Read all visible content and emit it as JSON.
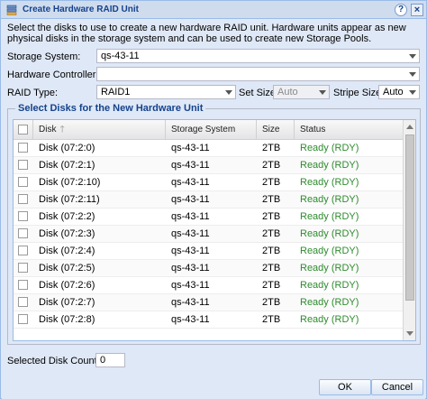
{
  "dialog": {
    "title": "Create Hardware RAID Unit",
    "title_icon": "raid-unit-icon",
    "help_label": "?",
    "close_label": "×"
  },
  "description": "Select the disks to use to create a new hardware RAID unit. Hardware units appear as new physical disks in the storage system and can be used to create new Storage Pools.",
  "form": {
    "storage_system_label": "Storage System:",
    "storage_system_value": "qs-43-11",
    "hardware_controller_label": "Hardware Controller:",
    "hardware_controller_value": "",
    "raid_type_label": "RAID Type:",
    "raid_type_value": "RAID1",
    "set_size_label": "Set Size:",
    "set_size_value": "Auto",
    "stripe_size_label": "Stripe Size:",
    "stripe_size_value": "Auto"
  },
  "disk_section": {
    "legend": "Select Disks for the New Hardware Unit",
    "columns": [
      "Disk",
      "Storage System",
      "Size",
      "Status"
    ],
    "rows": [
      {
        "disk": "Disk (07:2:0)",
        "system": "qs-43-11",
        "size": "2TB",
        "status": "Ready (RDY)"
      },
      {
        "disk": "Disk (07:2:1)",
        "system": "qs-43-11",
        "size": "2TB",
        "status": "Ready (RDY)"
      },
      {
        "disk": "Disk (07:2:10)",
        "system": "qs-43-11",
        "size": "2TB",
        "status": "Ready (RDY)"
      },
      {
        "disk": "Disk (07:2:11)",
        "system": "qs-43-11",
        "size": "2TB",
        "status": "Ready (RDY)"
      },
      {
        "disk": "Disk (07:2:2)",
        "system": "qs-43-11",
        "size": "2TB",
        "status": "Ready (RDY)"
      },
      {
        "disk": "Disk (07:2:3)",
        "system": "qs-43-11",
        "size": "2TB",
        "status": "Ready (RDY)"
      },
      {
        "disk": "Disk (07:2:4)",
        "system": "qs-43-11",
        "size": "2TB",
        "status": "Ready (RDY)"
      },
      {
        "disk": "Disk (07:2:5)",
        "system": "qs-43-11",
        "size": "2TB",
        "status": "Ready (RDY)"
      },
      {
        "disk": "Disk (07:2:6)",
        "system": "qs-43-11",
        "size": "2TB",
        "status": "Ready (RDY)"
      },
      {
        "disk": "Disk (07:2:7)",
        "system": "qs-43-11",
        "size": "2TB",
        "status": "Ready (RDY)"
      },
      {
        "disk": "Disk (07:2:8)",
        "system": "qs-43-11",
        "size": "2TB",
        "status": "Ready (RDY)"
      }
    ],
    "sort_icon": "sort-ascending-icon"
  },
  "selected_count": {
    "label": "Selected Disk Count:",
    "value": "0"
  },
  "buttons": {
    "ok": "OK",
    "cancel": "Cancel"
  },
  "colors": {
    "header_text": "#15428b",
    "status_ready": "#2e8b2e",
    "panel_bg": "#dfe8f6"
  }
}
